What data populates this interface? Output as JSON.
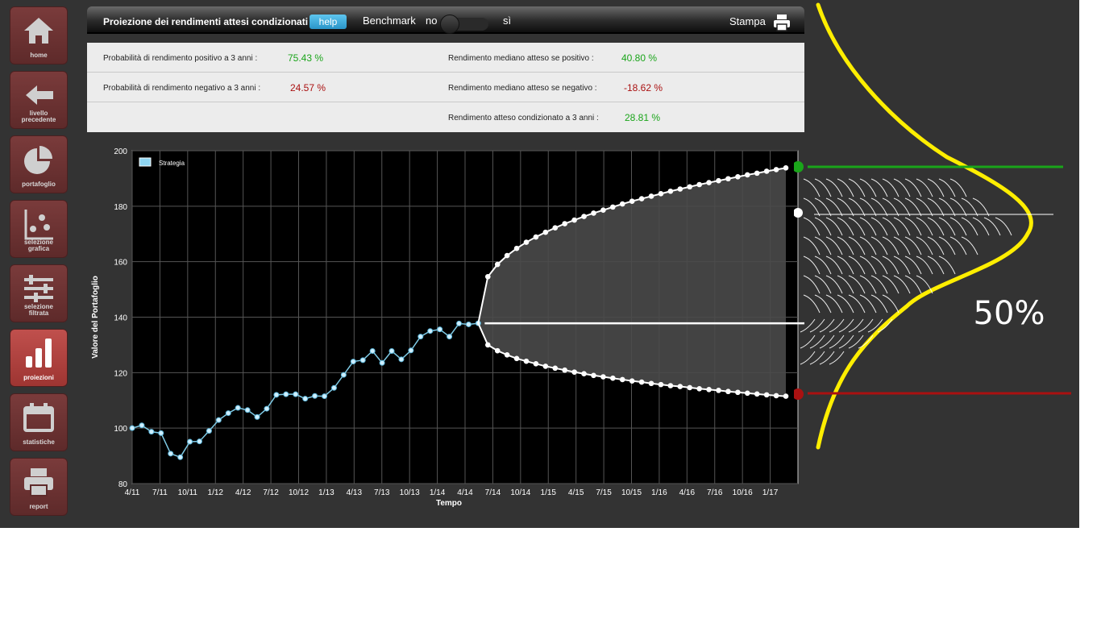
{
  "nav": {
    "items": [
      {
        "label": "home",
        "icon": "home-icon"
      },
      {
        "label": "livello\nprecedente",
        "icon": "arrow-left-icon"
      },
      {
        "label": "portafoglio",
        "icon": "pie-chart-icon"
      },
      {
        "label": "selezione\ngrafica",
        "icon": "scatter-chart-icon"
      },
      {
        "label": "selezione\nfiltrata",
        "icon": "sliders-icon"
      },
      {
        "label": "proiezioni",
        "icon": "bar-chart-icon",
        "active": true
      },
      {
        "label": "statistiche",
        "icon": "calendar-icon"
      },
      {
        "label": "report",
        "icon": "printer-icon"
      }
    ]
  },
  "topbar": {
    "title": "Proiezione dei rendimenti attesi condizionati",
    "help_label": "help",
    "benchmark_label": "Benchmark",
    "toggle_off_label": "no",
    "toggle_on_label": "sì",
    "toggle_state": "no",
    "print_label": "Stampa"
  },
  "stats": {
    "pos_prob_label": "Probabilità di rendimento positivo a 3 anni :",
    "pos_prob_value": "75.43 %",
    "neg_prob_label": "Probabilità di rendimento negativo a 3 anni :",
    "neg_prob_value": "24.57 %",
    "median_pos_label": "Rendimento mediano atteso se positivo :",
    "median_pos_value": "40.80 %",
    "median_neg_label": "Rendimento mediano atteso se negativo :",
    "median_neg_value": "-18.62 %",
    "cond_label": "Rendimento atteso condizionato a 3 anni :",
    "cond_value": "28.81 %"
  },
  "overlay": {
    "percent_label": "50%"
  },
  "colors": {
    "background": "#333333",
    "series_line": "#7fcbe6",
    "positive": "#1aa51a",
    "negative": "#aa1111",
    "bell_curve": "#ffee00"
  },
  "chart_data": {
    "type": "line",
    "xlabel": "Tempo",
    "ylabel": "Valore del Portafoglio",
    "ylim": [
      80,
      200
    ],
    "yticks": [
      80,
      100,
      120,
      140,
      160,
      180,
      200
    ],
    "xticks": [
      "4/11",
      "7/11",
      "10/11",
      "1/12",
      "4/12",
      "7/12",
      "10/12",
      "1/13",
      "4/13",
      "7/13",
      "10/13",
      "1/14",
      "4/14",
      "7/14",
      "10/14",
      "1/15",
      "4/15",
      "7/15",
      "10/15",
      "1/16",
      "4/16",
      "7/16",
      "10/16",
      "1/17"
    ],
    "grid": true,
    "legend": {
      "position": "top-left",
      "entries": [
        "Strategia"
      ]
    },
    "series": [
      {
        "name": "Strategia",
        "values": [
          100.0,
          101.0,
          98.7,
          98.2,
          90.8,
          89.5,
          95.1,
          95.2,
          99.0,
          102.9,
          105.4,
          107.3,
          106.5,
          104.0,
          107.0,
          112.0,
          112.2,
          112.2,
          110.6,
          111.6,
          111.5,
          114.5,
          119.2,
          124.0,
          124.5,
          127.8,
          123.5,
          127.8,
          124.8,
          128.0,
          133.0,
          135.0,
          135.6,
          133.0,
          137.7,
          137.4,
          137.8
        ]
      },
      {
        "name": "upper",
        "values": [
          137.8,
          154.6,
          159.0,
          162.2,
          164.8,
          167.0,
          168.9,
          170.6,
          172.2,
          173.7,
          175.0,
          176.3,
          177.5,
          178.6,
          179.7,
          180.8,
          181.8,
          182.7,
          183.6,
          184.5,
          185.4,
          186.2,
          187.0,
          187.8,
          188.5,
          189.2,
          189.9,
          190.6,
          191.3,
          191.9,
          192.6,
          193.2,
          193.8
        ]
      },
      {
        "name": "lower",
        "values": [
          137.8,
          130.0,
          127.9,
          126.4,
          125.1,
          124.1,
          123.2,
          122.3,
          121.6,
          120.9,
          120.2,
          119.6,
          119.0,
          118.5,
          118.0,
          117.5,
          117.0,
          116.6,
          116.1,
          115.7,
          115.3,
          115.0,
          114.6,
          114.2,
          113.9,
          113.6,
          113.2,
          112.9,
          112.6,
          112.3,
          112.0,
          111.7,
          111.5
        ]
      }
    ],
    "median_value": 137.8
  }
}
